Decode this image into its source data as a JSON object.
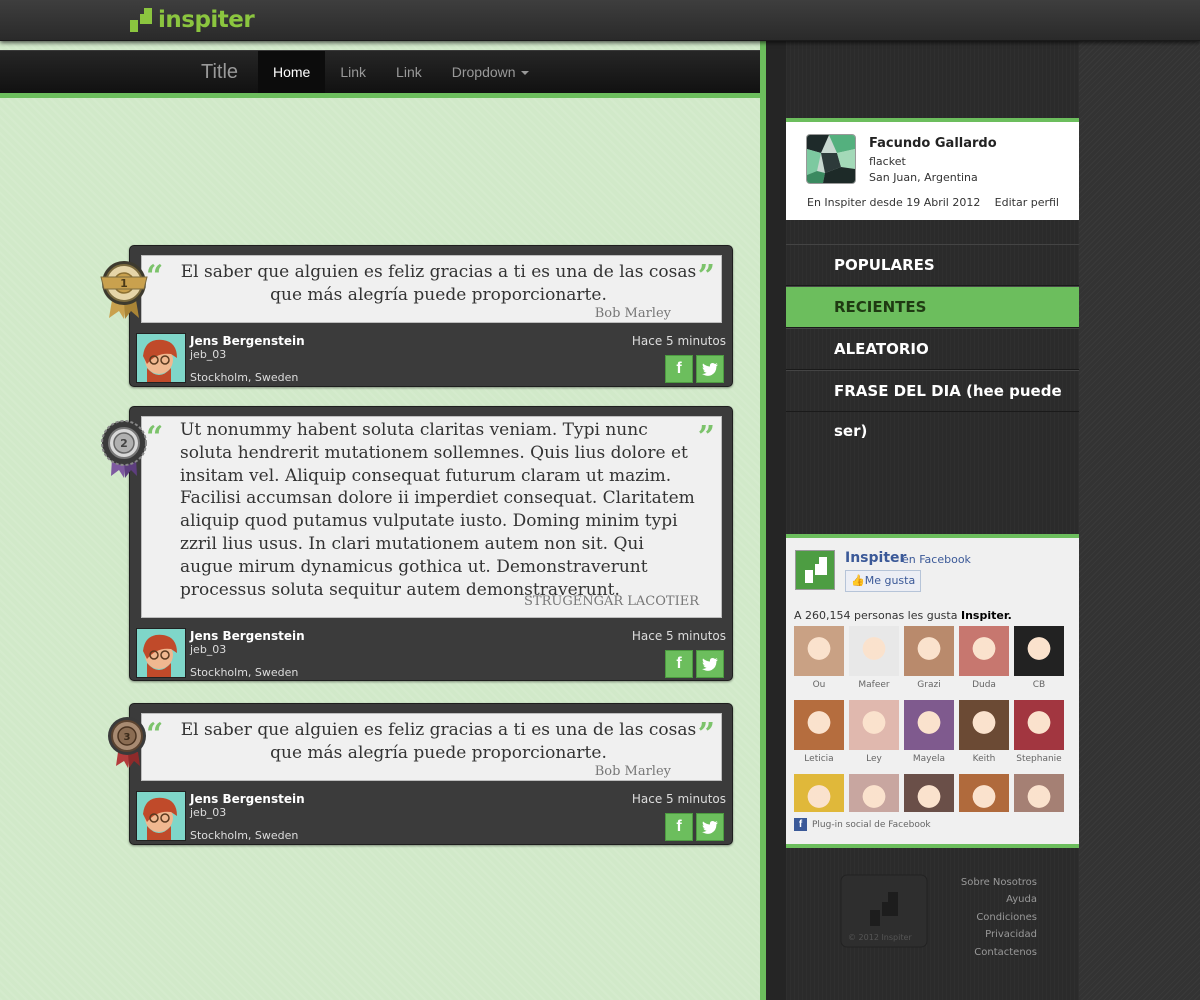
{
  "app": {
    "logo_text": "inspiter"
  },
  "navbar": {
    "brand": "Title",
    "items": [
      {
        "label": "Home",
        "active": true
      },
      {
        "label": "Link",
        "active": false
      },
      {
        "label": "Link",
        "active": false
      },
      {
        "label": "Dropdown",
        "active": false,
        "dropdown": true
      }
    ]
  },
  "quotes": [
    {
      "rank": "1",
      "badge": "gold",
      "text": "El saber que alguien es feliz gracias a ti es una de las cosas que más alegría puede proporcionarte.",
      "author": "Bob Marley",
      "user": {
        "name": "Jens Bergenstein",
        "handle": "jeb_03",
        "location": "Stockholm, Sweden"
      },
      "time": "Hace 5 minutos"
    },
    {
      "rank": "2",
      "badge": "silver",
      "text": "Ut nonummy habent soluta claritas veniam. Typi nunc soluta hendrerit mutationem sollemnes. Quis lius dolore et insitam vel. Aliquip consequat futurum claram ut mazim. Facilisi accumsan dolore ii imperdiet consequat. Claritatem aliquip quod putamus vulputate iusto. Doming minim typi zzril lius usus. In clari mutationem autem non sit. Qui augue mirum dynamicus gothica ut. Demonstraverunt processus soluta sequitur autem demonstraverunt.",
      "author": "STRUGENGAR LACOTIER",
      "user": {
        "name": "Jens Bergenstein",
        "handle": "jeb_03",
        "location": "Stockholm, Sweden"
      },
      "time": "Hace 5 minutos"
    },
    {
      "rank": "3",
      "badge": "bronze",
      "text": "El saber que alguien es feliz gracias a ti es una de las cosas que más alegría puede proporcionarte.",
      "author": "Bob Marley",
      "user": {
        "name": "Jens Bergenstein",
        "handle": "jeb_03",
        "location": "Stockholm, Sweden"
      },
      "time": "Hace 5 minutos"
    }
  ],
  "share": {
    "facebook": "f",
    "twitter": "t"
  },
  "profile": {
    "name": "Facundo Gallardo",
    "handle": "flacket",
    "location": "San Juan, Argentina",
    "since": "En Inspiter desde 19 Abril 2012",
    "edit": "Editar perfil"
  },
  "menu": [
    {
      "label": "POPULARES",
      "active": false
    },
    {
      "label": "RECIENTES",
      "active": true
    },
    {
      "label": "ALEATORIO",
      "active": false
    },
    {
      "label": "FRASE DEL DIA (hee puede ser)",
      "active": false
    }
  ],
  "facebook_box": {
    "page_name": "Inspiter",
    "on_facebook": "en Facebook",
    "like_button": "Me gusta",
    "count_prefix": "A 260,154 personas les gusta",
    "count_page": "Inspiter.",
    "friends": [
      "Ou",
      "Mafeer",
      "Grazi",
      "Duda",
      "CB",
      "Leticia",
      "Ley",
      "Mayela",
      "Keith",
      "Stephanie",
      "",
      "",
      "",
      "",
      ""
    ],
    "friend_colors": [
      "#c9a184",
      "#e8e8e8",
      "#b98a6c",
      "#c7776f",
      "#222222",
      "#b56d3e",
      "#e0b8ae",
      "#7f5a8e",
      "#6b4a34",
      "#a23640",
      "#e0b83a",
      "#c8a6a0",
      "#6a4f48",
      "#b06a3c",
      "#a58074"
    ],
    "plugin": "Plug-in social de Facebook"
  },
  "footer": {
    "copyright": "© 2012 Inspiter",
    "links": [
      "Sobre Nosotros",
      "Ayuda",
      "Condiciones",
      "Privacidad",
      "Contactenos"
    ]
  },
  "colors": {
    "accent": "#6cbe5d",
    "logo": "#8bc53f"
  }
}
